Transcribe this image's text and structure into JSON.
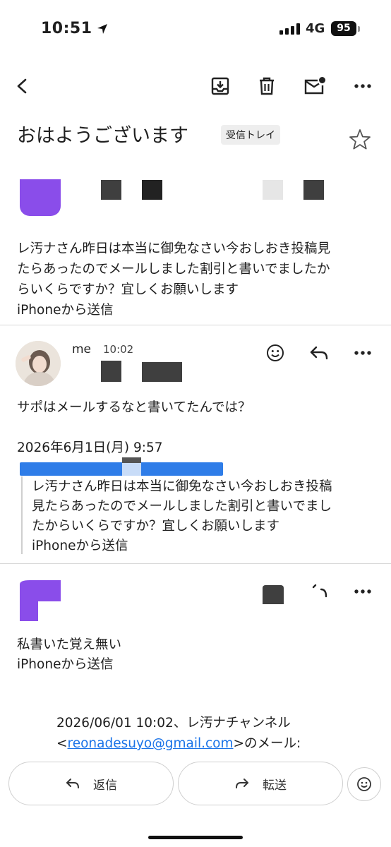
{
  "status_bar": {
    "time": "10:51",
    "network": "4G",
    "battery": "95"
  },
  "toolbar": {
    "icons": [
      "back-icon",
      "archive-icon",
      "delete-icon",
      "mark-unread-icon",
      "more-icon"
    ]
  },
  "subject": {
    "title": "おはようございます",
    "label": "受信トレイ"
  },
  "messages": [
    {
      "body": [
        "レ汚ナさん昨日は本当に御免なさい今おしおき投稿見",
        "たらあったのでメールしました割引と書いでましたか",
        "らいくらですか？宜しくお願いします",
        "iPhoneから送信"
      ]
    },
    {
      "sender": "me",
      "time": "10:02",
      "body": "サポはメールするなと書いてたんでは？",
      "quote_date": "2026年6月1日(月) 9:57",
      "quote": [
        "レ汚ナさん昨日は本当に御免なさい今おしおき投稿",
        "見たらあったのでメールしました割引と書いでまし",
        "たからいくらですか？宜しくお願いします",
        "iPhoneから送信"
      ]
    },
    {
      "body": [
        "私書いた覚え無い",
        "iPhoneから送信"
      ],
      "quote_header": "2026/06/01 10:02、レ汚ナチャンネル",
      "quote_email": "reonadesuyo@gmail.com",
      "quote_lt": "<",
      "quote_suffix": ">のメール:"
    }
  ],
  "actions": {
    "reply": "返信",
    "forward": "転送"
  },
  "colors": {
    "avatar_purple": "#8a4dea",
    "link_blue": "#1a73e8",
    "highlight_blue": "#2f7de8"
  }
}
